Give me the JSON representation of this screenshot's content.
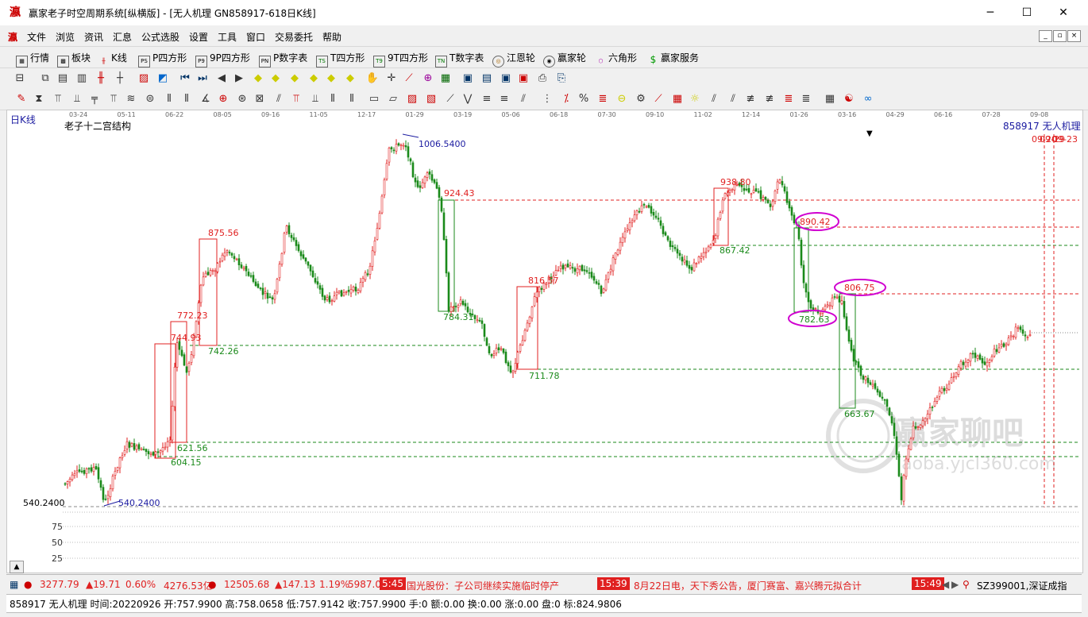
{
  "window": {
    "title": "赢家老子时空周期系统[纵横版] - [无人机理  GN858917-618日K线]",
    "app_icon": "瀛",
    "minimize": "─",
    "maximize": "☐",
    "close": "✕"
  },
  "menu": [
    "文件",
    "浏览",
    "资讯",
    "汇息",
    "公式选股",
    "设置",
    "工具",
    "窗口",
    "交易委托",
    "帮助"
  ],
  "menu_controls": [
    "_",
    "▫",
    "×"
  ],
  "toolbar": [
    {
      "label": "行情",
      "icon": "grid-icon"
    },
    {
      "label": "板块",
      "icon": "blocks-icon"
    },
    {
      "label": "K线",
      "icon": "kline-icon"
    },
    {
      "label": "P四方形",
      "icon": "ps-icon"
    },
    {
      "label": "9P四方形",
      "icon": "p9-icon"
    },
    {
      "label": "P数字表",
      "icon": "pn-icon"
    },
    {
      "label": "T四方形",
      "icon": "ts-icon"
    },
    {
      "label": "9T四方形",
      "icon": "t9-icon"
    },
    {
      "label": "T数字表",
      "icon": "tn-icon"
    },
    {
      "label": "江恩轮",
      "icon": "gann-wheel-icon"
    },
    {
      "label": "赢家轮",
      "icon": "winner-wheel-icon"
    },
    {
      "label": "六角形",
      "icon": "hexagon-icon"
    },
    {
      "label": "赢家服务",
      "icon": "dollar-icon"
    }
  ],
  "chart": {
    "period_label": "日K线",
    "indicator_title": "老子十二宫结构",
    "stock_label": "858917 无人机理",
    "right_date_label": "09-29",
    "right_date_label2": "09-23",
    "right_date_label3": "09-20",
    "watermark_cn": "赢家聊吧",
    "watermark_url": "laoba.yjcl360.com",
    "top_date_ticks": [
      "03-24",
      "05-11",
      "06-22",
      "08-05",
      "09-16",
      "11-05",
      "12-17",
      "01-29",
      "03-19",
      "05-06",
      "06-18",
      "07-30",
      "09-10",
      "11-02",
      "12-14",
      "01-26",
      "03-16",
      "04-29",
      "06-16",
      "07-28",
      "09-08"
    ],
    "low_label": "540.2400",
    "lower_axis": [
      "75",
      "50",
      "25"
    ],
    "price_labels": {
      "p1006": "1006.5400",
      "p540": "540.2400",
      "p924": "924.43",
      "p938": "938.80",
      "p875": "875.56",
      "p772": "772.23",
      "p742": "742.26",
      "p744": "744.93",
      "p621": "621.56",
      "p604": "604.15",
      "p816": "816.57",
      "p711": "711.78",
      "p784": "784.31",
      "p867": "867.42",
      "p890": "890.42",
      "p806": "806.75",
      "p782": "782.63",
      "p663": "663.67"
    },
    "colors": {
      "up": "#e02020",
      "down": "#1b8a1b",
      "line_red": "#e02020",
      "line_green": "#1b8a1b",
      "blue": "#1a1aa0",
      "magenta": "#d000d0"
    }
  },
  "status": {
    "sh_index": "3277.79",
    "sh_change": "▲19.71",
    "sh_pct": "0.60%",
    "sh_amount": "4276.53亿",
    "sz_index": "12505.68",
    "sz_change": "▲147.13",
    "sz_pct": "1.19%",
    "sz_amount": "5987.05",
    "news1_time": "5:45",
    "news1": "国光股份：子公司继续实施临时停产",
    "news2_time": "15:39",
    "news2": "8月22日电，天下秀公告，厦门赛富、嘉兴腾元拟合计",
    "news3_time": "15:49",
    "right_label": "SZ399001,深证成指"
  },
  "info_bar": {
    "text": "858917 无人机理 时间:20220926 开:757.9900 高:758.0658 低:757.9142 收:757.9900 手:0 额:0.00 换:0.00 涨:0.00 盘:0 标:824.9806"
  }
}
